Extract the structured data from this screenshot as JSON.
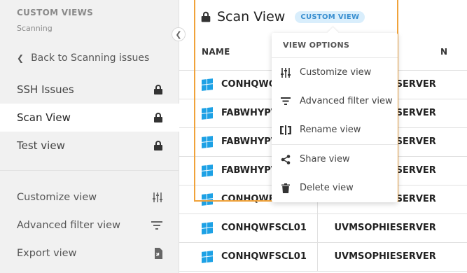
{
  "sidebar": {
    "title": "CUSTOM VIEWS",
    "subtitle": "Scanning",
    "back_label": "Back to Scanning issues",
    "views": [
      {
        "label": "SSH Issues",
        "locked": true
      },
      {
        "label": "Scan View",
        "locked": true,
        "active": true
      },
      {
        "label": "Test view",
        "locked": true
      }
    ],
    "actions": [
      {
        "label": "Customize view",
        "icon": "sliders-icon"
      },
      {
        "label": "Advanced filter view",
        "icon": "filter-icon"
      },
      {
        "label": "Export view",
        "icon": "export-icon"
      }
    ]
  },
  "header": {
    "title": "Scan View",
    "badge": "CUSTOM VIEW"
  },
  "table": {
    "columns": [
      "NAME",
      "N"
    ],
    "rows": [
      [
        "CONHQWCFSCL01",
        "UVMSOPHIESERVER"
      ],
      [
        "FABWHYPV",
        "UVMSOPHIESERVER"
      ],
      [
        "FABWHYPV",
        "UVMSOPHIESERVER"
      ],
      [
        "FABWHYPV",
        "UVMSOPHIESERVER"
      ],
      [
        "CONHQWFSCL01",
        "UVMSOPHIESERVER"
      ],
      [
        "CONHQWFSCL01",
        "UVMSOPHIESERVER"
      ],
      [
        "CONHQWFSCL01",
        "UVMSOPHIESERVER"
      ]
    ]
  },
  "dropdown": {
    "header": "VIEW OPTIONS",
    "items": [
      {
        "label": "Customize view",
        "icon": "sliders-icon"
      },
      {
        "label": "Advanced filter view",
        "icon": "filter-icon"
      },
      {
        "label": "Rename view",
        "icon": "rename-icon"
      },
      {
        "label": "Share view",
        "icon": "share-icon"
      },
      {
        "label": "Delete view",
        "icon": "trash-icon"
      }
    ]
  },
  "colors": {
    "accent": "#1da1e5",
    "highlight_frame": "#f0a23a",
    "badge_bg": "#d9eefc",
    "badge_text": "#3a8fd0"
  }
}
